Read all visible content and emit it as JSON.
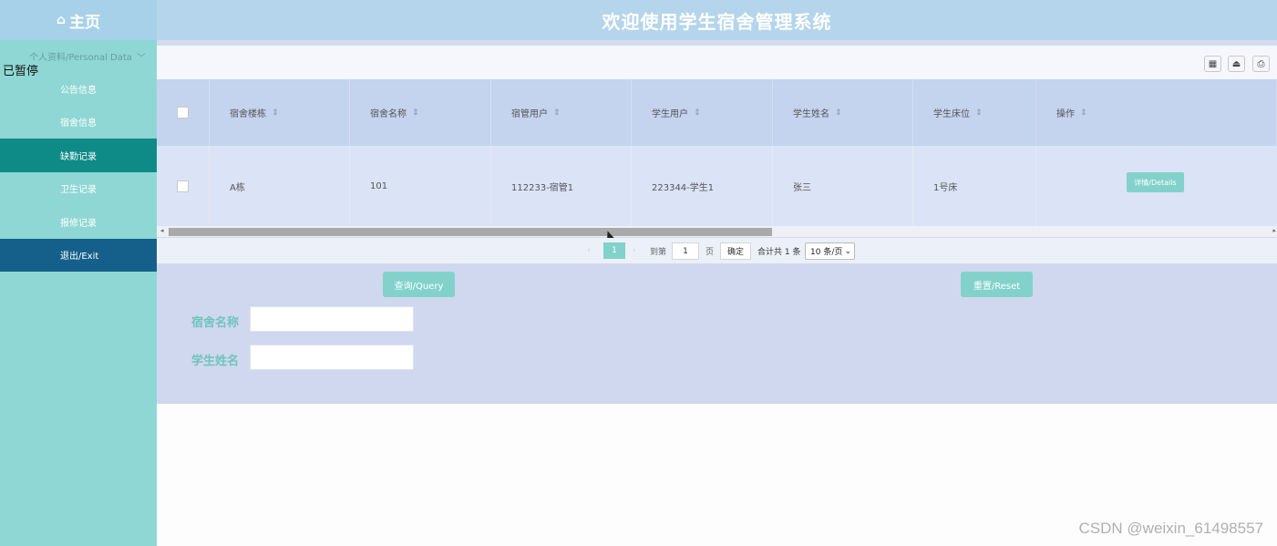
{
  "header": {
    "home_label": "主页",
    "title": "欢迎使用学生宿舍管理系统"
  },
  "sidebar": {
    "group_label": "个人资料/Personal Data",
    "overlay": "已暂停",
    "items": [
      {
        "label": "公告信息"
      },
      {
        "label": "宿舍信息"
      },
      {
        "label": "缺勤记录"
      },
      {
        "label": "卫生记录"
      },
      {
        "label": "报修记录"
      },
      {
        "label": "退出/Exit"
      }
    ]
  },
  "table": {
    "columns": [
      "宿舍楼栋",
      "宿舍名称",
      "宿管用户",
      "学生用户",
      "学生姓名",
      "学生床位",
      "操作"
    ],
    "rows": [
      {
        "building": "A栋",
        "dorm": "101",
        "manager": "112233-宿管1",
        "student_user": "223344-学生1",
        "student_name": "张三",
        "bed": "1号床",
        "action": "详情/Details"
      }
    ]
  },
  "pagination": {
    "current_page": "1",
    "goto_label": "到第",
    "goto_value": "1",
    "page_label": "页",
    "confirm_label": "确定",
    "total_label": "合计共 1 条",
    "page_size": "10 条/页"
  },
  "search": {
    "query_label": "查询/Query",
    "reset_label": "重置/Reset",
    "dorm_name_label": "宿舍名称",
    "student_name_label": "学生姓名"
  },
  "watermark": "CSDN @weixin_61498557",
  "colors": {
    "accent": "#82d2cb",
    "sidebar": "#8fd7d4",
    "active": "#0e8a87",
    "exit": "#15608a",
    "header": "#b5d5ec"
  }
}
